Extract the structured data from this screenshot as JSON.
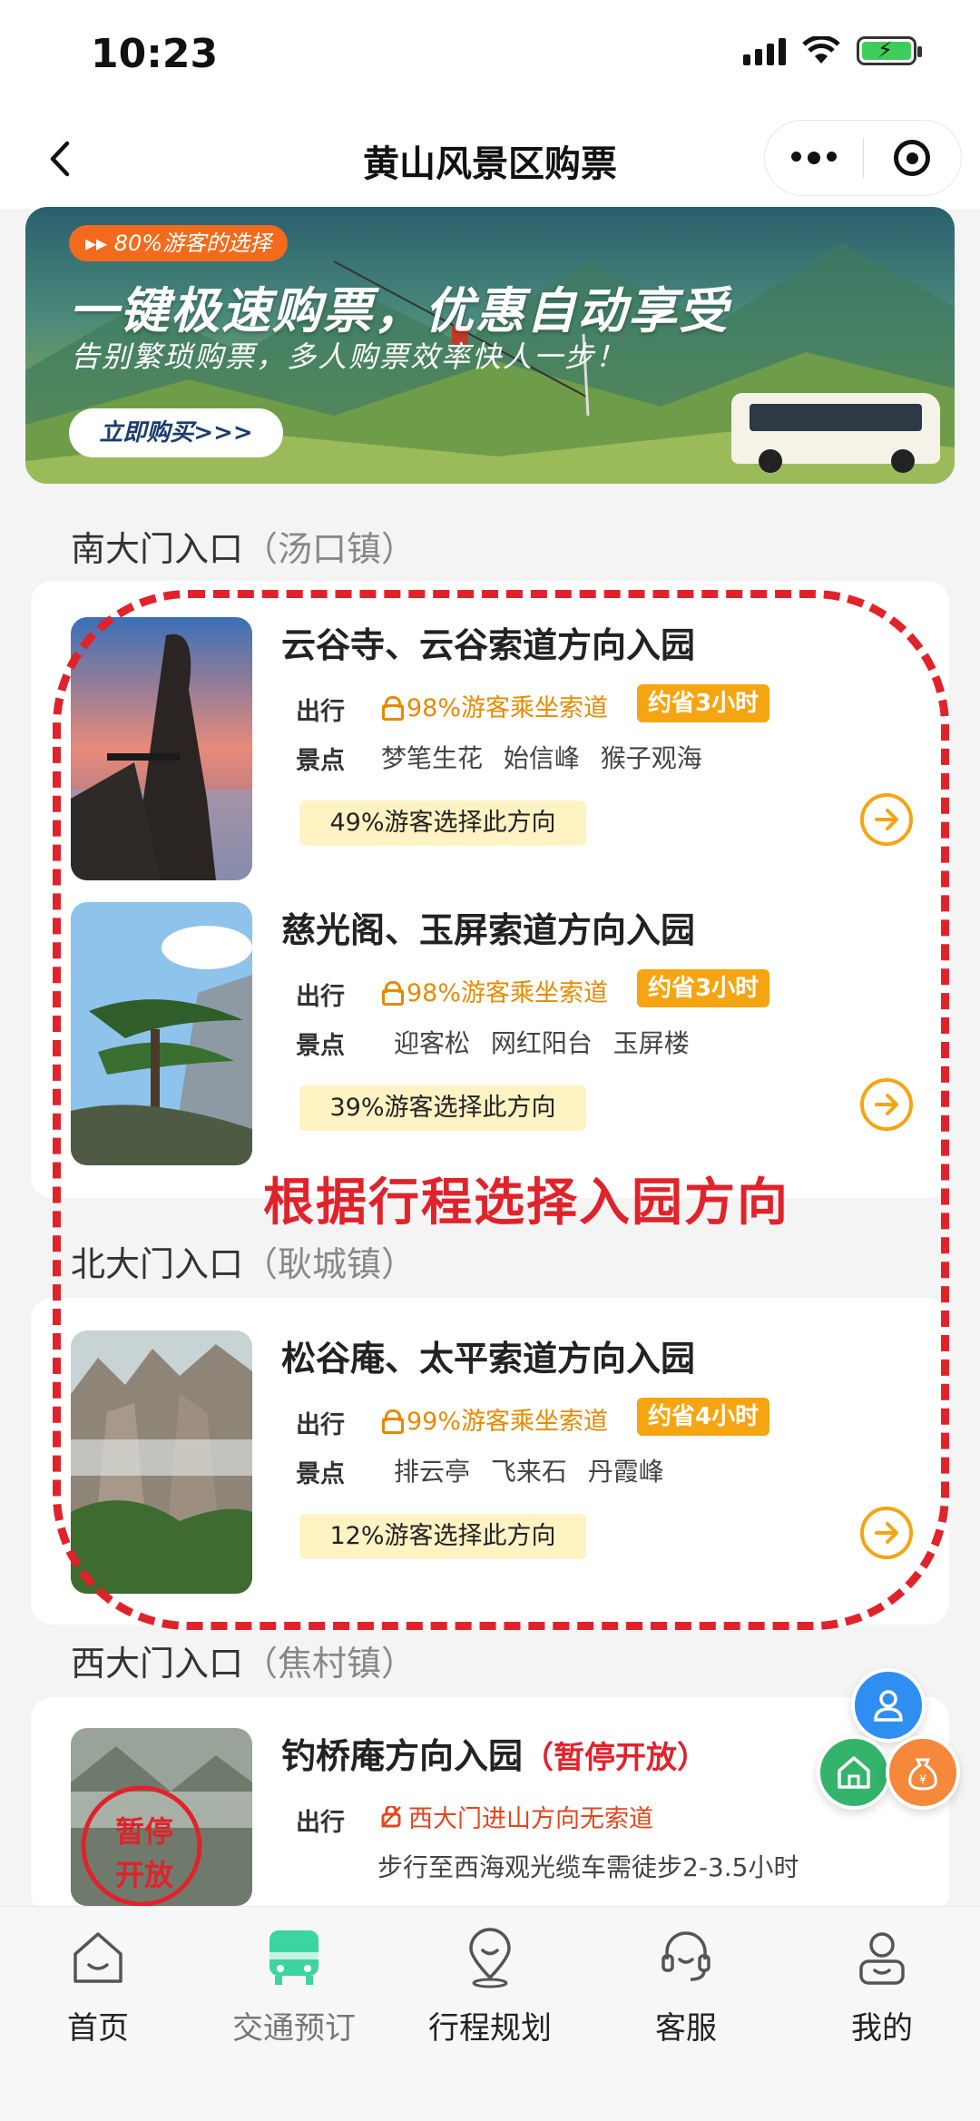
{
  "status_bar": {
    "time": "10:23"
  },
  "nav": {
    "title": "黄山风景区购票"
  },
  "banner": {
    "tag": "▸▸ 80%游客的选择",
    "title": "一键极速购票，优惠自动享受",
    "subtitle": "告别繁琐购票，多人购票效率快人一步！",
    "button": "立即购买>>>"
  },
  "sections": [
    {
      "name": "南大门入口",
      "town": "（汤口镇）",
      "routes": [
        {
          "title": "云谷寺、云谷索道方向入园",
          "travel_label": "出行",
          "cable": "98%游客乘坐索道",
          "save": "约省3小时",
          "spots_label": "景点",
          "spots": "梦笔生花  始信峰  猴子观海",
          "percent": "49%游客选择此方向"
        },
        {
          "title": "慈光阁、玉屏索道方向入园",
          "travel_label": "出行",
          "cable": "98%游客乘坐索道",
          "save": "约省3小时",
          "spots_label": "景点",
          "spots": "迎客松  网红阳台  玉屏楼",
          "percent": "39%游客选择此方向"
        }
      ]
    },
    {
      "name": "北大门入口",
      "town": "（耿城镇）",
      "routes": [
        {
          "title": "松谷庵、太平索道方向入园",
          "travel_label": "出行",
          "cable": "99%游客乘坐索道",
          "save": "约省4小时",
          "spots_label": "景点",
          "spots": "排云亭  飞来石  丹霞峰",
          "percent": "12%游客选择此方向"
        }
      ]
    },
    {
      "name": "西大门入口",
      "town": "（焦村镇）",
      "routes": [
        {
          "title": "钓桥庵方向入园",
          "suspended": "（暂停开放）",
          "travel_label": "出行",
          "cable": "西大门进山方向无索道",
          "note": "步行至西海观光缆车需徒步2-3.5小时",
          "stamp": "暂停开放"
        }
      ]
    }
  ],
  "annotation": {
    "text": "根据行程选择入园方向"
  },
  "tabs": [
    {
      "label": "首页"
    },
    {
      "label": "交通预订"
    },
    {
      "label": "行程规划"
    },
    {
      "label": "客服"
    },
    {
      "label": "我的"
    }
  ],
  "colors": {
    "accent_orange": "#f5a512",
    "annotation_red": "#e0232b",
    "active_tab_green": "#3ed4a0"
  }
}
